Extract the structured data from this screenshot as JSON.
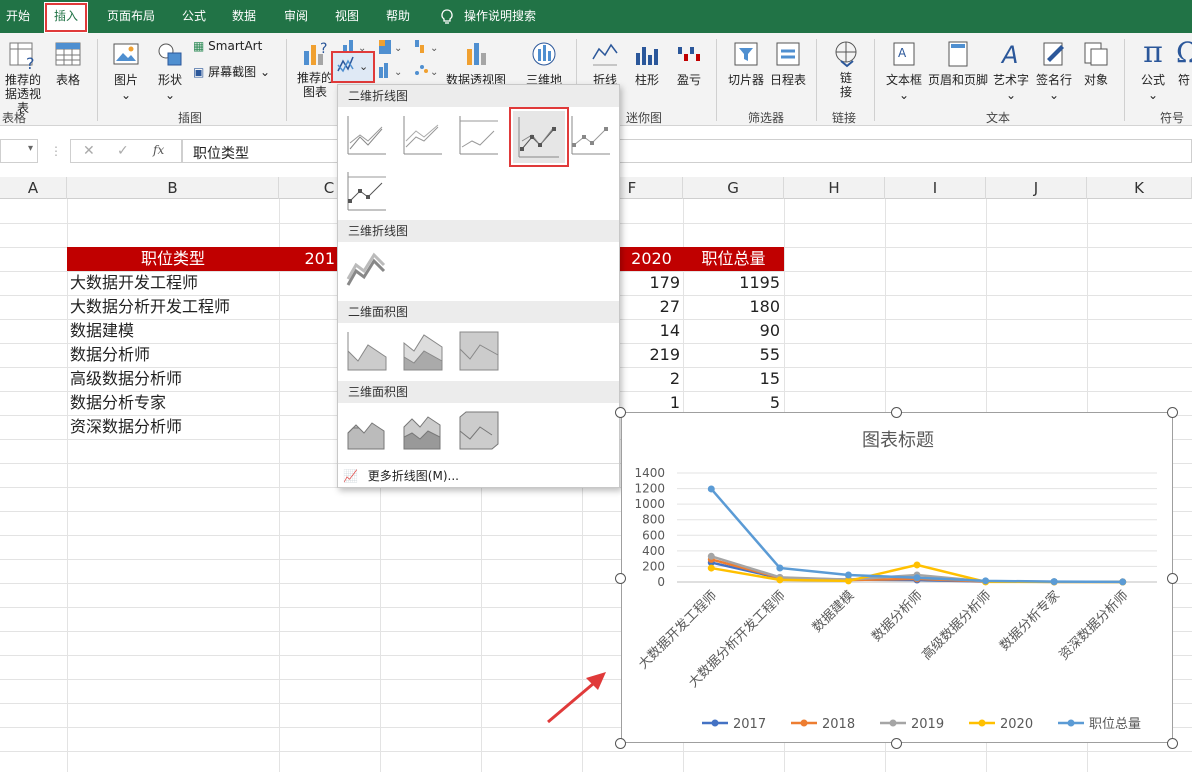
{
  "menu": {
    "tabs": [
      "开始",
      "插入",
      "页面布局",
      "公式",
      "数据",
      "审阅",
      "视图",
      "帮助"
    ],
    "search_label": "操作说明搜索"
  },
  "ribbon": {
    "pivot_label": "推荐的\n据透视表",
    "table_label": "表格",
    "group_tables": "表格",
    "pictures_label": "图片",
    "shapes_label": "形状",
    "smartart_label": "SmartArt",
    "screenshot_label": "屏幕截图",
    "group_illustrations": "插图",
    "recommended_charts_label": "推荐的\n图表",
    "pivotchart_label": "数据透视图",
    "map3d_label": "三维地",
    "spark_line_label": "折线",
    "spark_column_label": "柱形",
    "spark_winloss_label": "盈亏",
    "group_sparklines": "迷你图",
    "slicer_label": "切片器",
    "timeline_label": "日程表",
    "group_filters": "筛选器",
    "link_label": "链\n接",
    "group_links": "链接",
    "textbox_label": "文本框",
    "headerfooter_label": "页眉和页脚",
    "wordart_label": "艺术字",
    "signature_label": "签名行",
    "object_label": "对象",
    "group_text": "文本",
    "equation_label": "公式",
    "symbol_label": "符",
    "group_symbols": "符号"
  },
  "formula_bar": {
    "name_box": "",
    "cancel": "✕",
    "enter": "✓",
    "fx": "fx",
    "content": "职位类型"
  },
  "columns": [
    "A",
    "B",
    "C",
    "D",
    "E",
    "F",
    "G",
    "H",
    "I",
    "J",
    "K"
  ],
  "table": {
    "header_b": "职位类型",
    "header_c_partial": "201",
    "header_f": "2020",
    "header_g": "职位总量",
    "rows": [
      {
        "name": "大数据开发工程师",
        "f": "179",
        "g": "1195"
      },
      {
        "name": "大数据分析开发工程师",
        "f": "27",
        "g": "180"
      },
      {
        "name": "数据建模",
        "f": "14",
        "g": "90"
      },
      {
        "name": "数据分析师",
        "f": "219",
        "g": "55"
      },
      {
        "name": "高级数据分析师",
        "f": "2",
        "g": "15"
      },
      {
        "name": "数据分析专家",
        "f": "1",
        "g": "5"
      },
      {
        "name": "资深数据分析师",
        "f": "",
        "g": ""
      }
    ]
  },
  "dropdown": {
    "sec1": "二维折线图",
    "sec2": "三维折线图",
    "sec3": "二维面积图",
    "sec4": "三维面积图",
    "more": "更多折线图(M)..."
  },
  "chart_data": {
    "type": "line",
    "title": "图表标题",
    "categories": [
      "大数据开发工程师",
      "大数据分析开发工程师",
      "数据建模",
      "数据分析师",
      "高级数据分析师",
      "数据分析专家",
      "资深数据分析师"
    ],
    "ylim": [
      0,
      1400
    ],
    "yticks": [
      0,
      200,
      400,
      600,
      800,
      1000,
      1200,
      1400
    ],
    "grid": true,
    "legend": "bottom",
    "series": [
      {
        "name": "2017",
        "color": "#4472c4",
        "values": [
          250,
          50,
          30,
          25,
          5,
          2,
          1
        ]
      },
      {
        "name": "2018",
        "color": "#ed7d31",
        "values": [
          290,
          55,
          25,
          40,
          6,
          2,
          1
        ]
      },
      {
        "name": "2019",
        "color": "#a5a5a5",
        "values": [
          330,
          60,
          30,
          90,
          8,
          3,
          1
        ]
      },
      {
        "name": "2020",
        "color": "#ffc000",
        "values": [
          179,
          27,
          14,
          219,
          2,
          1,
          0
        ]
      },
      {
        "name": "职位总量",
        "color": "#5b9bd5",
        "values": [
          1195,
          180,
          90,
          55,
          15,
          5,
          1
        ]
      }
    ]
  }
}
